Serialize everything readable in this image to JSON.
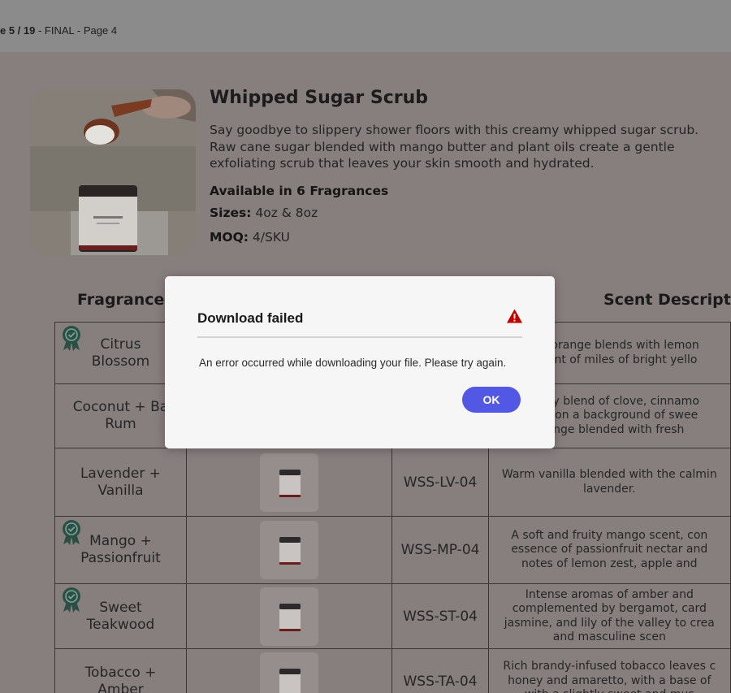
{
  "topbar": {
    "page_count": "e 5 / 19",
    "doc_name": " - FINAL - Page 4"
  },
  "product": {
    "title": "Whipped Sugar Scrub",
    "description": "Say goodbye to slippery shower floors with this creamy whipped sugar scrub. Raw cane sugar blended with mango butter and plant oils create a gentle exfoliating scrub that leaves your skin smooth and hydrated.",
    "fragrances_line": "Available in 6 Fragrances",
    "sizes_label": "Sizes:",
    "sizes_value": " 4oz & 8oz",
    "moq_label": "MOQ:",
    "moq_value": " 4/SKU"
  },
  "table": {
    "header_fragrances": "Fragrances",
    "header_scent": "Scent Descriptio",
    "rows": [
      {
        "name": [
          "Citrus",
          "Blossom"
        ],
        "badge": true,
        "sku": "",
        "scent": [
          "weet orange blends with lemon",
          "iniscent of miles of bright yello"
        ]
      },
      {
        "name": [
          "Coconut + Ba",
          "Rum"
        ],
        "badge": false,
        "sku": "",
        "scent": [
          "e spicy blend of clove, cinnamo",
          "edles on a background of swee",
          "orange blended with fresh"
        ]
      },
      {
        "name": [
          "Lavender +",
          "Vanilla"
        ],
        "badge": false,
        "sku": "WSS-LV-04",
        "scent": [
          "Warm vanilla blended with the calmin",
          "lavender."
        ]
      },
      {
        "name": [
          "Mango +",
          "Passionfruit"
        ],
        "badge": true,
        "sku": "WSS-MP-04",
        "scent": [
          "A soft and fruity mango scent, con",
          "essence of passionfruit nectar and",
          "notes of lemon zest, apple and"
        ]
      },
      {
        "name": [
          "Sweet",
          "Teakwood"
        ],
        "badge": true,
        "sku": "WSS-ST-04",
        "scent": [
          "Intense aromas of amber and",
          "complemented by bergamot, card",
          "jasmine, and lily of the valley to crea",
          "and masculine scen"
        ]
      },
      {
        "name": [
          "Tobacco +",
          "Amber"
        ],
        "badge": false,
        "sku": "WSS-TA-04",
        "scent": [
          "Rich brandy-infused tobacco leaves c",
          "honey and amaretto, with a base of",
          "with a slightly sweet and mus"
        ]
      }
    ]
  },
  "modal": {
    "title": "Download failed",
    "message": "An error occurred while downloading your file. Please try again.",
    "ok_label": "OK",
    "icon": "warning-triangle-icon",
    "accent": "#5258e4",
    "warn_color": "#c00000"
  }
}
